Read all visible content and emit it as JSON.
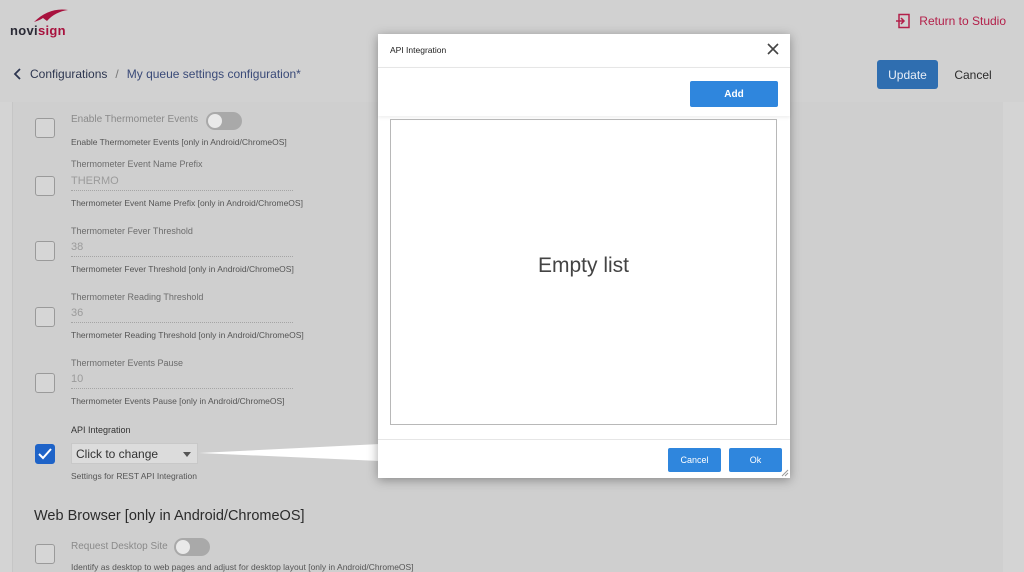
{
  "header": {
    "logo_prefix": "novi",
    "logo_suffix": "sign",
    "return_label": "Return to Studio"
  },
  "breadcrumb": {
    "root": "Configurations",
    "separator": "/",
    "current": "My queue settings configuration*"
  },
  "actions": {
    "update_label": "Update",
    "cancel_label": "Cancel"
  },
  "settings": {
    "thermo_events": {
      "toggle_label": "Enable Thermometer Events",
      "help": "Enable Thermometer Events [only in Android/ChromeOS]"
    },
    "thermo_prefix": {
      "label": "Thermometer Event Name Prefix",
      "value": "THERMO",
      "help": "Thermometer Event Name Prefix [only in Android/ChromeOS]"
    },
    "fever_threshold": {
      "label": "Thermometer Fever Threshold",
      "value": "38",
      "help": "Thermometer Fever Threshold [only in Android/ChromeOS]"
    },
    "reading_threshold": {
      "label": "Thermometer Reading Threshold",
      "value": "36",
      "help": "Thermometer Reading Threshold [only in Android/ChromeOS]"
    },
    "events_pause": {
      "label": "Thermometer Events Pause",
      "value": "10",
      "help": "Thermometer Events Pause [only in Android/ChromeOS]"
    },
    "api_integration": {
      "label": "API Integration",
      "select_value": "Click to change",
      "help": "Settings for REST API Integration"
    },
    "web_browser": {
      "section_title": "Web Browser [only in Android/ChromeOS]",
      "toggle_label": "Request Desktop Site",
      "help": "Identify as desktop to web pages and adjust for desktop layout [only in Android/ChromeOS]"
    }
  },
  "modal": {
    "title": "API Integration",
    "add_label": "Add",
    "empty_text": "Empty list",
    "cancel_label": "Cancel",
    "ok_label": "Ok"
  },
  "colors": {
    "brand": "#a8123e",
    "primary_button": "#2f86dd",
    "update_button": "#2f6eb0",
    "checkbox_checked": "#1e63c8"
  }
}
